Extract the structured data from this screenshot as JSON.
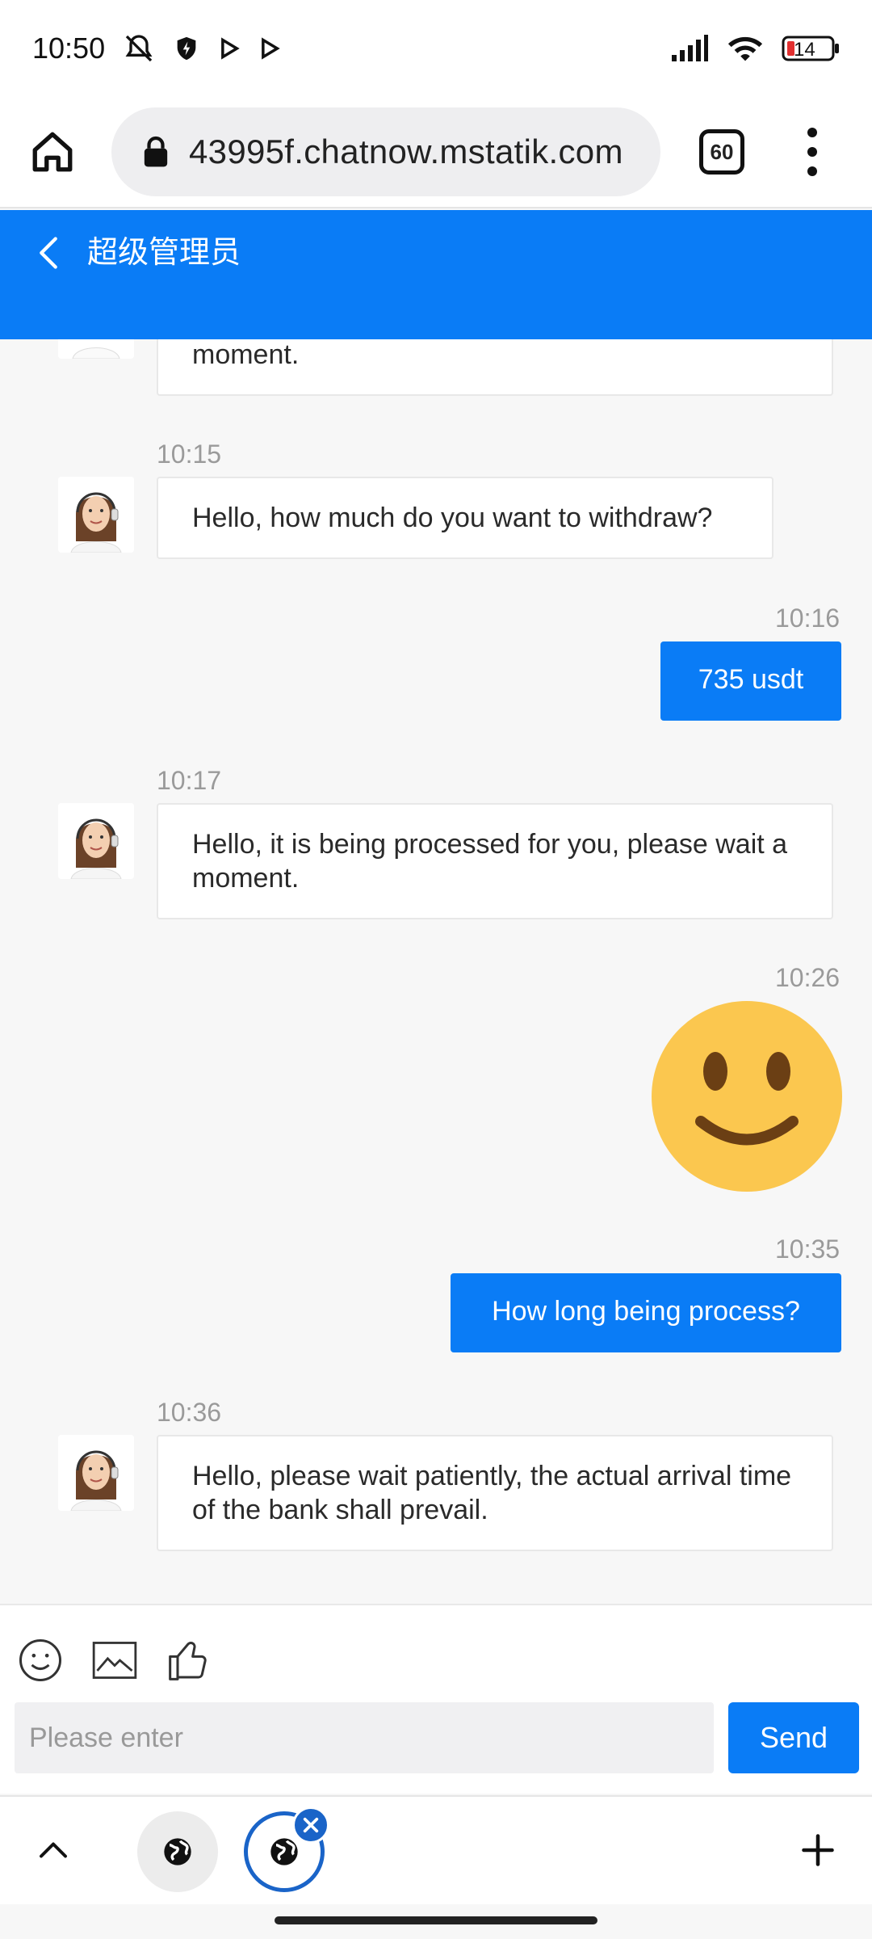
{
  "status_bar": {
    "time": "10:50",
    "battery": "14"
  },
  "browser": {
    "url": "43995f.chatnow.mstatik.com",
    "tab_count": "60"
  },
  "header": {
    "title": "超级管理员"
  },
  "messages": [
    {
      "from": "agent",
      "time": "",
      "text": "moment."
    },
    {
      "from": "agent",
      "time": "10:15",
      "text": "Hello, how much do you want to withdraw?"
    },
    {
      "from": "user",
      "time": "10:16",
      "text": "735 usdt"
    },
    {
      "from": "agent",
      "time": "10:17",
      "text": "Hello, it is being processed for you, please wait a moment."
    },
    {
      "from": "user",
      "time": "10:26",
      "text": "",
      "type": "emoji",
      "icon": "smiley-emoji-icon"
    },
    {
      "from": "user",
      "time": "10:35",
      "text": "How long being process?"
    },
    {
      "from": "agent",
      "time": "10:36",
      "text": "Hello, please wait patiently, the actual arrival time of the bank shall prevail."
    }
  ],
  "composer": {
    "placeholder": "Please enter",
    "send_label": "Send"
  },
  "colors": {
    "accent": "#0a7cf6",
    "tab_active": "#1a64c8"
  }
}
